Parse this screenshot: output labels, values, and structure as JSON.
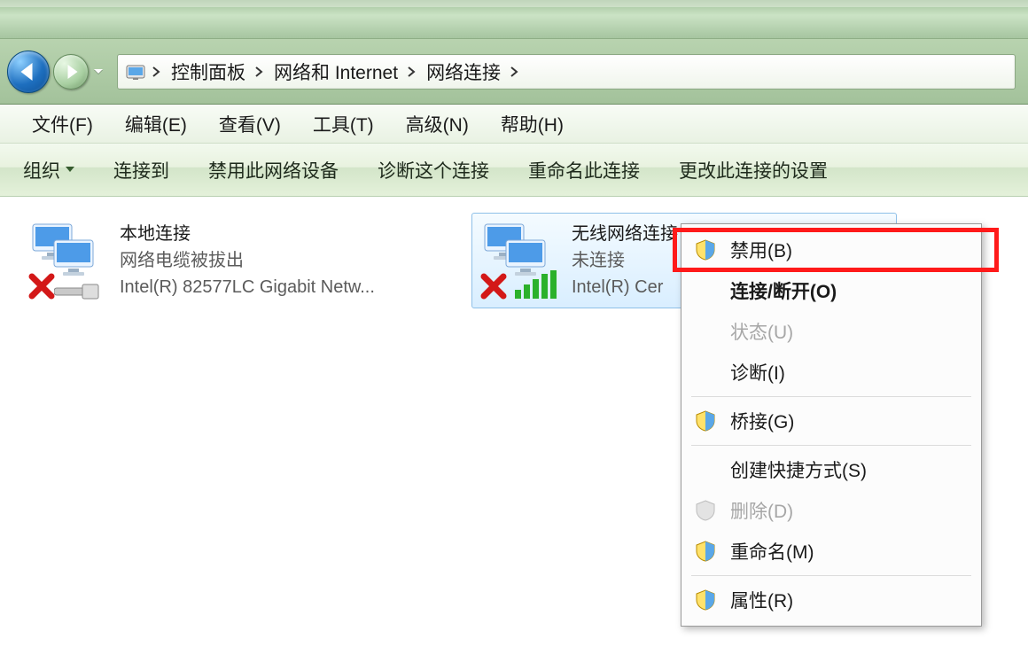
{
  "breadcrumb": {
    "segments": [
      "控制面板",
      "网络和 Internet",
      "网络连接"
    ]
  },
  "menubar": {
    "items": [
      "文件(F)",
      "编辑(E)",
      "查看(V)",
      "工具(T)",
      "高级(N)",
      "帮助(H)"
    ]
  },
  "cmdbar": {
    "organize": "组织",
    "connect_to": "连接到",
    "disable_device": "禁用此网络设备",
    "diagnose": "诊断这个连接",
    "rename": "重命名此连接",
    "change_settings": "更改此连接的设置"
  },
  "connections": [
    {
      "name": "本地连接",
      "status": "网络电缆被拔出",
      "device": "Intel(R) 82577LC Gigabit Netw...",
      "kind": "ethernet"
    },
    {
      "name": "无线网络连接",
      "status": "未连接",
      "device": "Intel(R) Cer",
      "kind": "wifi"
    }
  ],
  "context_menu": {
    "disable": "禁用(B)",
    "connect_disconnect": "连接/断开(O)",
    "status": "状态(U)",
    "diagnose": "诊断(I)",
    "bridge": "桥接(G)",
    "shortcut": "创建快捷方式(S)",
    "delete": "删除(D)",
    "rename": "重命名(M)",
    "properties": "属性(R)"
  }
}
